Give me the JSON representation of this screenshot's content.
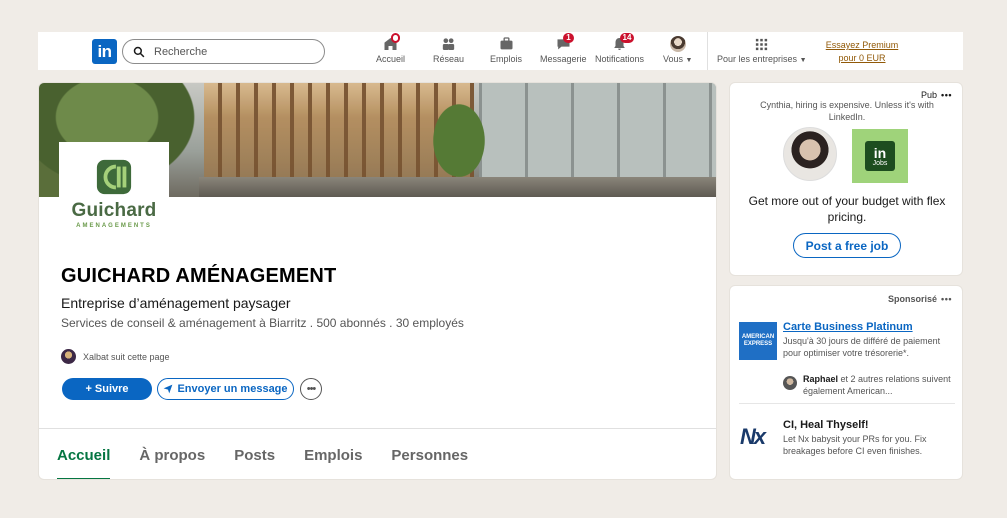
{
  "nav": {
    "logo_text": "in",
    "search_placeholder": "Recherche",
    "items": [
      {
        "label": "Accueil",
        "icon": "home-icon",
        "badge": "dot"
      },
      {
        "label": "Réseau",
        "icon": "network-icon",
        "badge": ""
      },
      {
        "label": "Emplois",
        "icon": "briefcase-icon",
        "badge": ""
      },
      {
        "label": "Messagerie",
        "icon": "messaging-icon",
        "badge": "1"
      },
      {
        "label": "Notifications",
        "icon": "bell-icon",
        "badge": "14"
      },
      {
        "label": "Vous",
        "icon": "avatar",
        "badge": ""
      }
    ],
    "business_label": "Pour les entreprises",
    "premium_line1": "Essayez Premium",
    "premium_line2": "pour 0 EUR"
  },
  "company": {
    "logo_name": "Guichard",
    "logo_sub": "AMENAGEMENTS",
    "name": "GUICHARD AMÉNAGEMENT",
    "tagline": "Entreprise d’aménagement paysager",
    "meta": "Services de conseil & aménagement à Biarritz . 500 abonnés . 30 employés",
    "follower_text": "Xalbat suit cette page",
    "follow_button": "+ Suivre",
    "message_button": "Envoyer un message",
    "more_button": "•••"
  },
  "tabs": [
    "Accueil",
    "À propos",
    "Posts",
    "Emplois",
    "Personnes"
  ],
  "active_tab": "Accueil",
  "ad": {
    "label": "Pub",
    "more": "•••",
    "hire_text": "Cynthia, hiring is expensive. Unless it's with LinkedIn.",
    "jobs_logo": "in",
    "jobs_text": "Jobs",
    "copy": "Get more out of your budget with flex pricing.",
    "button": "Post a free job"
  },
  "sponsored": {
    "label": "Sponsorisé",
    "more": "•••",
    "item1": {
      "logo_line1": "AMERICAN",
      "logo_line2": "EXPRESS",
      "title": "Carte Business Platinum",
      "desc": "Jusqu'à 30 jours de différé de paiement pour optimiser votre trésorerie*.",
      "social_name": "Raphael",
      "social_rest": " et 2 autres relations suivent également American..."
    },
    "item2": {
      "logo": "Nx",
      "title": "CI, Heal Thyself!",
      "desc": "Let Nx babysit your PRs for you. Fix breakages before CI even finishes."
    }
  },
  "colors": {
    "brand_blue": "#0a66c2",
    "active_tab_green": "#057642",
    "badge_red": "#cb112d",
    "premium_gold": "#915907"
  }
}
